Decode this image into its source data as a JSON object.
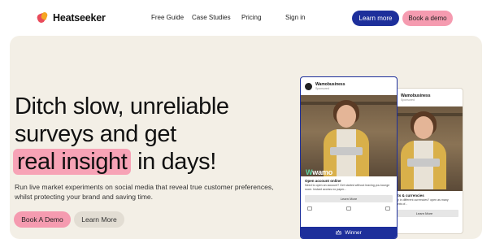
{
  "brand": {
    "name": "Heatseeker"
  },
  "nav": {
    "links": [
      "Free Guide",
      "Case Studies",
      "Pricing",
      "Sign in"
    ],
    "learn_more": "Learn more",
    "book_demo": "Book a demo"
  },
  "hero": {
    "headline_line1": "Ditch slow, unreliable",
    "headline_line2": "surveys and get",
    "headline_highlight": "real insight",
    "headline_rest": "in days!",
    "subtext": "Run live market experiments on social media that reveal true customer preferences, whilst protecting your brand and saving time.",
    "cta_primary": "Book A Demo",
    "cta_secondary": "Learn More"
  },
  "ad_front": {
    "account": "Wamobusiness",
    "sponsored": "Sponsored",
    "brand_overlay": "wamo",
    "title": "Open account online",
    "desc": "Need to open an account? Get started without leaving you lounge room. Instant access no paper...",
    "button": "Learn More",
    "winner_label": "Winner"
  },
  "ad_back": {
    "account": "Wamobusiness",
    "sponsored": "Sponsored",
    "title": "ments & currencies",
    "desc": "money in different currencies? open as many accounts of...",
    "button": "Learn More"
  },
  "colors": {
    "accent_blue": "#1d2f9b",
    "accent_pink": "#f59bb0",
    "hero_bg": "#f3efe6"
  }
}
